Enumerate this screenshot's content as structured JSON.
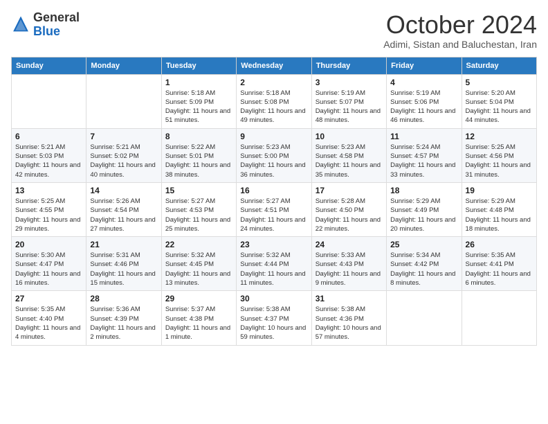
{
  "header": {
    "logo_general": "General",
    "logo_blue": "Blue",
    "month_title": "October 2024",
    "subtitle": "Adimi, Sistan and Baluchestan, Iran"
  },
  "weekdays": [
    "Sunday",
    "Monday",
    "Tuesday",
    "Wednesday",
    "Thursday",
    "Friday",
    "Saturday"
  ],
  "weeks": [
    [
      {
        "day": null
      },
      {
        "day": null
      },
      {
        "day": "1",
        "sunrise": "Sunrise: 5:18 AM",
        "sunset": "Sunset: 5:09 PM",
        "daylight": "Daylight: 11 hours and 51 minutes."
      },
      {
        "day": "2",
        "sunrise": "Sunrise: 5:18 AM",
        "sunset": "Sunset: 5:08 PM",
        "daylight": "Daylight: 11 hours and 49 minutes."
      },
      {
        "day": "3",
        "sunrise": "Sunrise: 5:19 AM",
        "sunset": "Sunset: 5:07 PM",
        "daylight": "Daylight: 11 hours and 48 minutes."
      },
      {
        "day": "4",
        "sunrise": "Sunrise: 5:19 AM",
        "sunset": "Sunset: 5:06 PM",
        "daylight": "Daylight: 11 hours and 46 minutes."
      },
      {
        "day": "5",
        "sunrise": "Sunrise: 5:20 AM",
        "sunset": "Sunset: 5:04 PM",
        "daylight": "Daylight: 11 hours and 44 minutes."
      }
    ],
    [
      {
        "day": "6",
        "sunrise": "Sunrise: 5:21 AM",
        "sunset": "Sunset: 5:03 PM",
        "daylight": "Daylight: 11 hours and 42 minutes."
      },
      {
        "day": "7",
        "sunrise": "Sunrise: 5:21 AM",
        "sunset": "Sunset: 5:02 PM",
        "daylight": "Daylight: 11 hours and 40 minutes."
      },
      {
        "day": "8",
        "sunrise": "Sunrise: 5:22 AM",
        "sunset": "Sunset: 5:01 PM",
        "daylight": "Daylight: 11 hours and 38 minutes."
      },
      {
        "day": "9",
        "sunrise": "Sunrise: 5:23 AM",
        "sunset": "Sunset: 5:00 PM",
        "daylight": "Daylight: 11 hours and 36 minutes."
      },
      {
        "day": "10",
        "sunrise": "Sunrise: 5:23 AM",
        "sunset": "Sunset: 4:58 PM",
        "daylight": "Daylight: 11 hours and 35 minutes."
      },
      {
        "day": "11",
        "sunrise": "Sunrise: 5:24 AM",
        "sunset": "Sunset: 4:57 PM",
        "daylight": "Daylight: 11 hours and 33 minutes."
      },
      {
        "day": "12",
        "sunrise": "Sunrise: 5:25 AM",
        "sunset": "Sunset: 4:56 PM",
        "daylight": "Daylight: 11 hours and 31 minutes."
      }
    ],
    [
      {
        "day": "13",
        "sunrise": "Sunrise: 5:25 AM",
        "sunset": "Sunset: 4:55 PM",
        "daylight": "Daylight: 11 hours and 29 minutes."
      },
      {
        "day": "14",
        "sunrise": "Sunrise: 5:26 AM",
        "sunset": "Sunset: 4:54 PM",
        "daylight": "Daylight: 11 hours and 27 minutes."
      },
      {
        "day": "15",
        "sunrise": "Sunrise: 5:27 AM",
        "sunset": "Sunset: 4:53 PM",
        "daylight": "Daylight: 11 hours and 25 minutes."
      },
      {
        "day": "16",
        "sunrise": "Sunrise: 5:27 AM",
        "sunset": "Sunset: 4:51 PM",
        "daylight": "Daylight: 11 hours and 24 minutes."
      },
      {
        "day": "17",
        "sunrise": "Sunrise: 5:28 AM",
        "sunset": "Sunset: 4:50 PM",
        "daylight": "Daylight: 11 hours and 22 minutes."
      },
      {
        "day": "18",
        "sunrise": "Sunrise: 5:29 AM",
        "sunset": "Sunset: 4:49 PM",
        "daylight": "Daylight: 11 hours and 20 minutes."
      },
      {
        "day": "19",
        "sunrise": "Sunrise: 5:29 AM",
        "sunset": "Sunset: 4:48 PM",
        "daylight": "Daylight: 11 hours and 18 minutes."
      }
    ],
    [
      {
        "day": "20",
        "sunrise": "Sunrise: 5:30 AM",
        "sunset": "Sunset: 4:47 PM",
        "daylight": "Daylight: 11 hours and 16 minutes."
      },
      {
        "day": "21",
        "sunrise": "Sunrise: 5:31 AM",
        "sunset": "Sunset: 4:46 PM",
        "daylight": "Daylight: 11 hours and 15 minutes."
      },
      {
        "day": "22",
        "sunrise": "Sunrise: 5:32 AM",
        "sunset": "Sunset: 4:45 PM",
        "daylight": "Daylight: 11 hours and 13 minutes."
      },
      {
        "day": "23",
        "sunrise": "Sunrise: 5:32 AM",
        "sunset": "Sunset: 4:44 PM",
        "daylight": "Daylight: 11 hours and 11 minutes."
      },
      {
        "day": "24",
        "sunrise": "Sunrise: 5:33 AM",
        "sunset": "Sunset: 4:43 PM",
        "daylight": "Daylight: 11 hours and 9 minutes."
      },
      {
        "day": "25",
        "sunrise": "Sunrise: 5:34 AM",
        "sunset": "Sunset: 4:42 PM",
        "daylight": "Daylight: 11 hours and 8 minutes."
      },
      {
        "day": "26",
        "sunrise": "Sunrise: 5:35 AM",
        "sunset": "Sunset: 4:41 PM",
        "daylight": "Daylight: 11 hours and 6 minutes."
      }
    ],
    [
      {
        "day": "27",
        "sunrise": "Sunrise: 5:35 AM",
        "sunset": "Sunset: 4:40 PM",
        "daylight": "Daylight: 11 hours and 4 minutes."
      },
      {
        "day": "28",
        "sunrise": "Sunrise: 5:36 AM",
        "sunset": "Sunset: 4:39 PM",
        "daylight": "Daylight: 11 hours and 2 minutes."
      },
      {
        "day": "29",
        "sunrise": "Sunrise: 5:37 AM",
        "sunset": "Sunset: 4:38 PM",
        "daylight": "Daylight: 11 hours and 1 minute."
      },
      {
        "day": "30",
        "sunrise": "Sunrise: 5:38 AM",
        "sunset": "Sunset: 4:37 PM",
        "daylight": "Daylight: 10 hours and 59 minutes."
      },
      {
        "day": "31",
        "sunrise": "Sunrise: 5:38 AM",
        "sunset": "Sunset: 4:36 PM",
        "daylight": "Daylight: 10 hours and 57 minutes."
      },
      {
        "day": null
      },
      {
        "day": null
      }
    ]
  ]
}
